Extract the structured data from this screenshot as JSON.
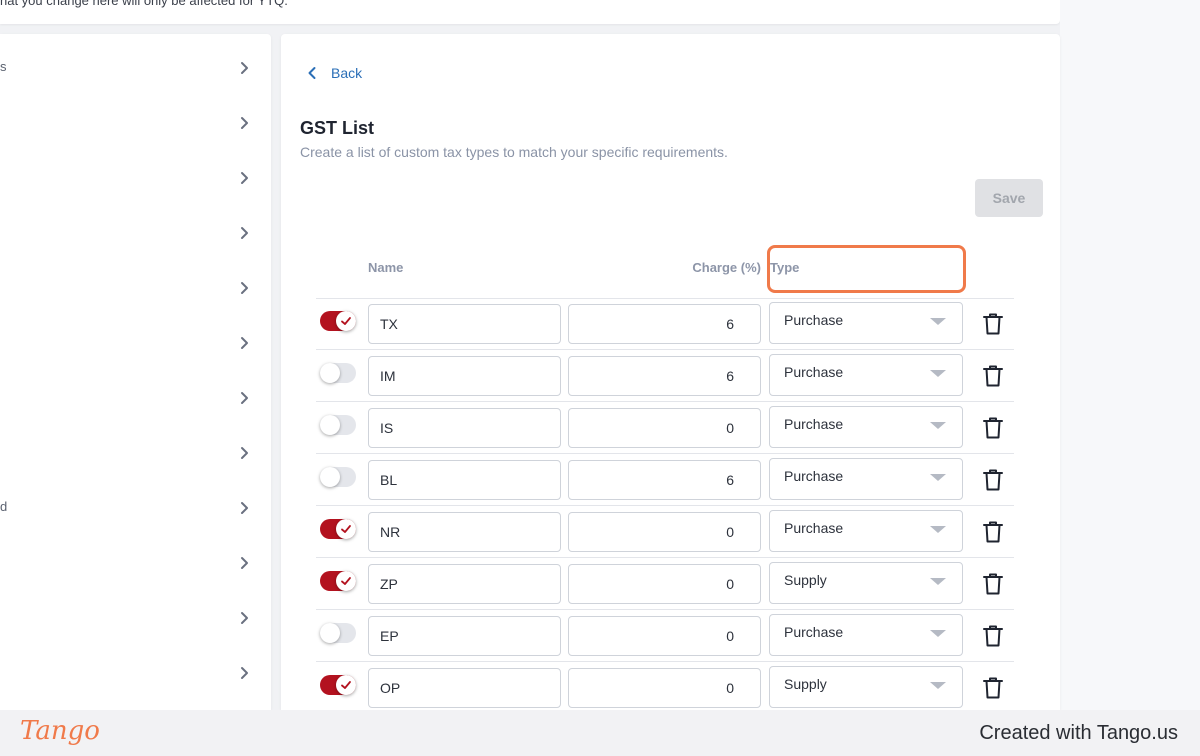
{
  "top_notice": "hat you change here will only be affected for YTQ.",
  "sidebar": {
    "items": [
      {
        "label": "s"
      },
      {
        "label": ""
      },
      {
        "label": ""
      },
      {
        "label": ""
      },
      {
        "label": ""
      },
      {
        "label": ""
      },
      {
        "label": ""
      },
      {
        "label": ""
      },
      {
        "label": "d"
      },
      {
        "label": ""
      },
      {
        "label": ""
      },
      {
        "label": ""
      }
    ]
  },
  "main": {
    "back_label": "Back",
    "title": "GST List",
    "subtitle": "Create a list of custom tax types to match your specific requirements.",
    "save_label": "Save",
    "columns": {
      "name": "Name",
      "charge": "Charge (%)",
      "type": "Type"
    },
    "rows": [
      {
        "enabled": true,
        "name": "TX",
        "charge": "6",
        "type": "Purchase"
      },
      {
        "enabled": false,
        "name": "IM",
        "charge": "6",
        "type": "Purchase"
      },
      {
        "enabled": false,
        "name": "IS",
        "charge": "0",
        "type": "Purchase"
      },
      {
        "enabled": false,
        "name": "BL",
        "charge": "6",
        "type": "Purchase"
      },
      {
        "enabled": true,
        "name": "NR",
        "charge": "0",
        "type": "Purchase"
      },
      {
        "enabled": true,
        "name": "ZP",
        "charge": "0",
        "type": "Supply"
      },
      {
        "enabled": false,
        "name": "EP",
        "charge": "0",
        "type": "Purchase"
      },
      {
        "enabled": true,
        "name": "OP",
        "charge": "0",
        "type": "Supply"
      }
    ]
  },
  "footer": {
    "logo_text": "Tango",
    "created_text": "Created with Tango.us"
  },
  "colors": {
    "accent_link": "#2b6fb7",
    "toggle_on": "#b3121f",
    "highlight": "#f07a4a"
  }
}
